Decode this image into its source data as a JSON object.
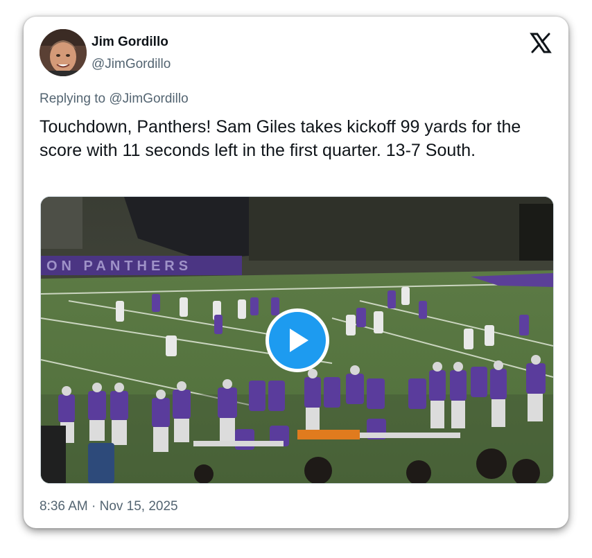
{
  "author": {
    "name": "Jim Gordillo",
    "handle": "@JimGordillo"
  },
  "reply": {
    "prefix": "Replying to ",
    "to_handle": "@JimGordillo"
  },
  "tweet": {
    "text": "Touchdown, Panthers! Sam Giles takes kickoff 99 yards for the score with 11 seconds left in the first quarter. 13-7 South."
  },
  "media": {
    "type": "video",
    "stadium_wall_text": "ON PANTHERS",
    "play_icon": "play-icon"
  },
  "footer": {
    "timestamp": "8:36 AM · Nov 15, 2025"
  },
  "icons": {
    "brand": "x-logo-icon"
  },
  "colors": {
    "accent": "#1d9bf0",
    "text_primary": "#0f1419",
    "text_secondary": "#536471",
    "team_purple": "#4b2a8a"
  }
}
